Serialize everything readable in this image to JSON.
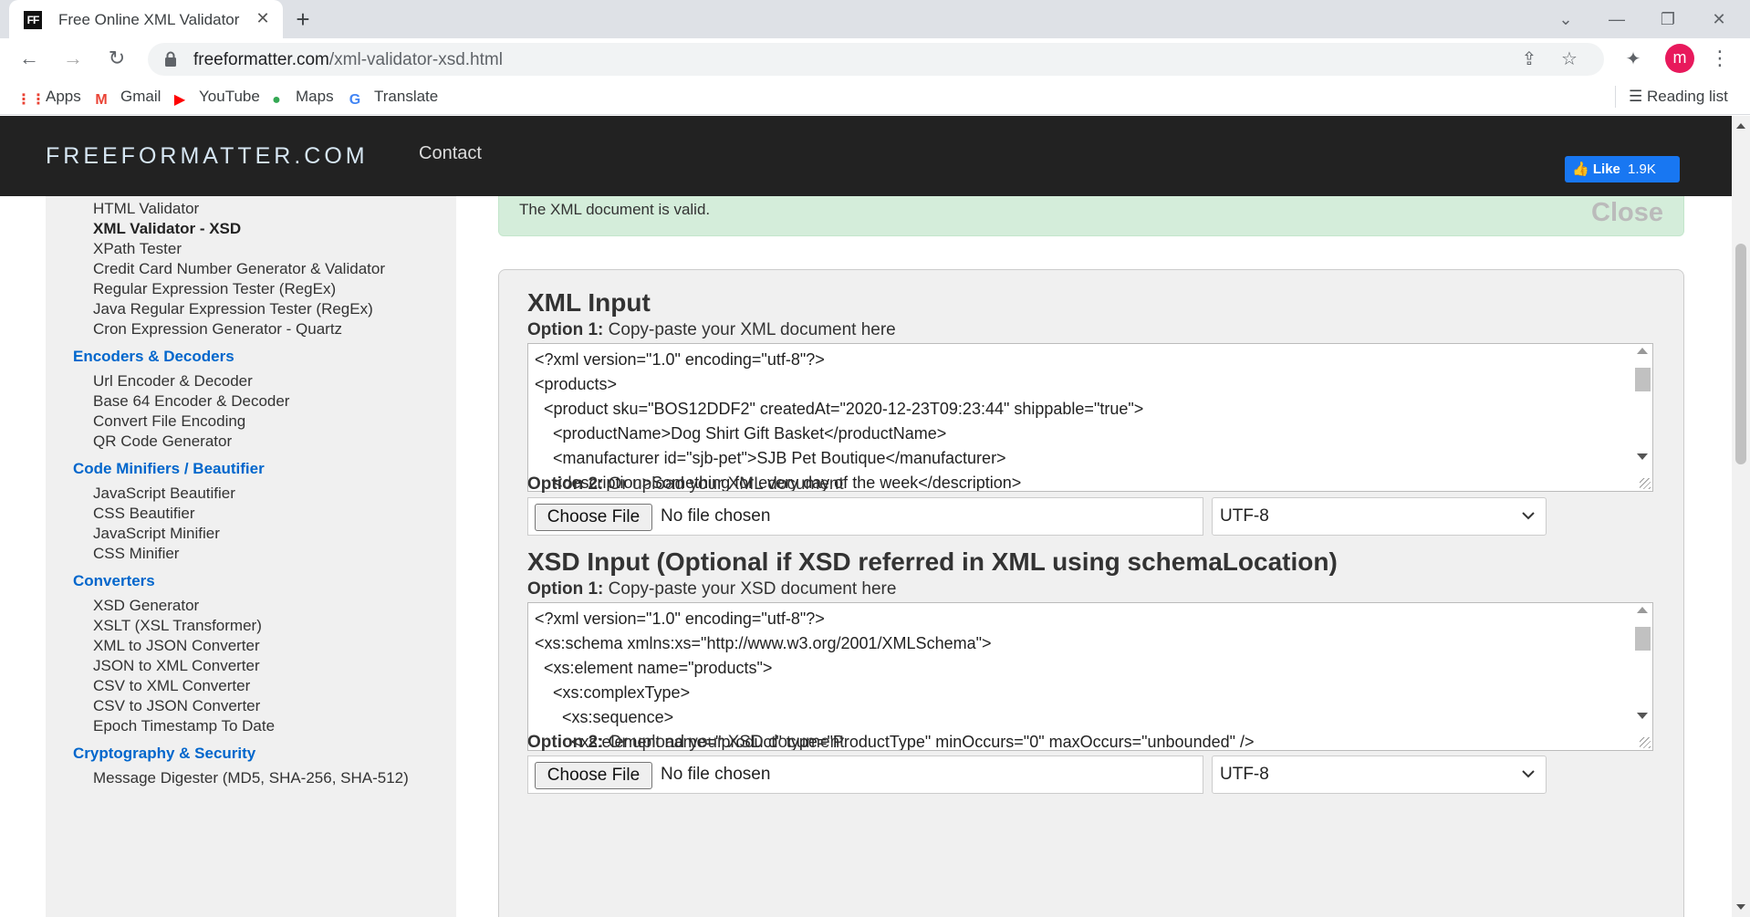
{
  "browser": {
    "tab": {
      "favicon_text": "FF",
      "title": "Free Online XML Validator Against XSD",
      "close_icon": "close-icon"
    },
    "new_tab_symbol": "+",
    "window_controls": {
      "tabsearch": "⌄",
      "minimize": "—",
      "restore": "❐",
      "close": "✕"
    },
    "toolbar": {
      "back": "←",
      "forward": "→",
      "reload": "↻"
    },
    "url": {
      "host": "freeformatter.com",
      "path": "/xml-validator-xsd.html"
    },
    "profile_initial": "m",
    "bookmarks": [
      {
        "label": "Apps",
        "icon": "apps-icon",
        "glyph": "⋮⋮",
        "color": "#ea4335"
      },
      {
        "label": "Gmail",
        "icon": "gmail-icon",
        "glyph": "M",
        "color": "#ea4335"
      },
      {
        "label": "YouTube",
        "icon": "youtube-icon",
        "glyph": "▶",
        "color": "#ff0000"
      },
      {
        "label": "Maps",
        "icon": "maps-icon",
        "glyph": "●",
        "color": "#34a853"
      },
      {
        "label": "Translate",
        "icon": "translate-icon",
        "glyph": "G",
        "color": "#4285f4"
      }
    ],
    "reading_list": "Reading list"
  },
  "site": {
    "logo": "FREEFORMATTER.COM",
    "nav_contact": "Contact",
    "fb_like": {
      "label": "Like",
      "count": "1.9K"
    }
  },
  "sidebar": {
    "validators": [
      "HTML Validator",
      "XML Validator - XSD",
      "XPath Tester",
      "Credit Card Number Generator & Validator",
      "Regular Expression Tester (RegEx)",
      "Java Regular Expression Tester (RegEx)",
      "Cron Expression Generator - Quartz"
    ],
    "active_item": "XML Validator - XSD",
    "sections": [
      {
        "heading": "Encoders & Decoders",
        "items": [
          "Url Encoder & Decoder",
          "Base 64 Encoder & Decoder",
          "Convert File Encoding",
          "QR Code Generator"
        ]
      },
      {
        "heading": "Code Minifiers / Beautifier",
        "items": [
          "JavaScript Beautifier",
          "CSS Beautifier",
          "JavaScript Minifier",
          "CSS Minifier"
        ]
      },
      {
        "heading": "Converters",
        "items": [
          "XSD Generator",
          "XSLT (XSL Transformer)",
          "XML to JSON Converter",
          "JSON to XML Converter",
          "CSV to XML Converter",
          "CSV to JSON Converter",
          "Epoch Timestamp To Date"
        ]
      },
      {
        "heading": "Cryptography & Security",
        "items": [
          "Message Digester (MD5, SHA-256, SHA-512)"
        ]
      }
    ]
  },
  "alert": {
    "message": "The XML document is valid.",
    "close_label": "Close"
  },
  "xml_section": {
    "title": "XML Input",
    "option1_bold": "Option 1:",
    "option1_text": " Copy-paste your XML document here",
    "code_lines": [
      "<?xml version=\"1.0\" encoding=\"utf-8\"?>",
      "<products>",
      "  <product sku=\"BOS12DDF2\" createdAt=\"2020-12-23T09:23:44\" shippable=\"true\">",
      "    <productName>Dog Shirt Gift Basket</productName>",
      "    <manufacturer id=\"sjb-pet\">SJB Pet Boutique</manufacturer>",
      "    <description>Something for every day of the week</description>"
    ],
    "option2_bold": "Option 2:",
    "option2_text": " Or upload your XML document",
    "choose_file": "Choose File",
    "no_file": "No file chosen",
    "encoding": "UTF-8"
  },
  "xsd_section": {
    "title": "XSD Input (Optional if XSD referred in XML using schemaLocation)",
    "option1_bold": "Option 1:",
    "option1_text": " Copy-paste your XSD document here",
    "code_lines": [
      "<?xml version=\"1.0\" encoding=\"utf-8\"?>",
      "<xs:schema xmlns:xs=\"http://www.w3.org/2001/XMLSchema\">",
      "  <xs:element name=\"products\">",
      "    <xs:complexType>",
      "      <xs:sequence>",
      "        <xs:element name=\"product\" type=\"ProductType\" minOccurs=\"0\" maxOccurs=\"unbounded\" />"
    ],
    "option2_bold": "Option 2:",
    "option2_text": " Or upload your XSD document",
    "choose_file": "Choose File",
    "no_file": "No file chosen",
    "encoding": "UTF-8"
  }
}
